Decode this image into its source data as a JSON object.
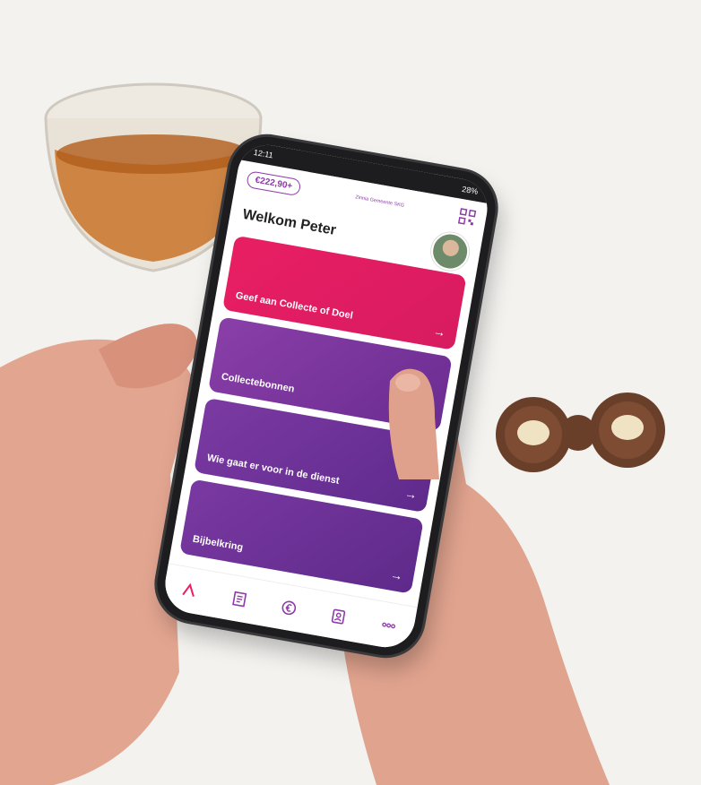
{
  "status_bar": {
    "time": "12:11",
    "battery": "28%"
  },
  "app": {
    "balance": "€222,90+",
    "org_name": "Zinnia Gemeente SKG",
    "welcome": "Welkom Peter"
  },
  "cards": [
    {
      "label": "Geef aan Collecte of Doel",
      "arrow": "→"
    },
    {
      "label": "Collectebonnen",
      "arrow": "→"
    },
    {
      "label": "Wie gaat er voor in de dienst",
      "arrow": "→"
    },
    {
      "label": "Bijbelkring",
      "arrow": "→"
    }
  ],
  "tabbar": {
    "items": [
      "home-icon",
      "news-icon",
      "euro-icon",
      "contacts-icon",
      "more-icon"
    ]
  },
  "colors": {
    "pink": "#e91e63",
    "purple": "#7b3aa3",
    "accent": "#8e3aa8"
  }
}
